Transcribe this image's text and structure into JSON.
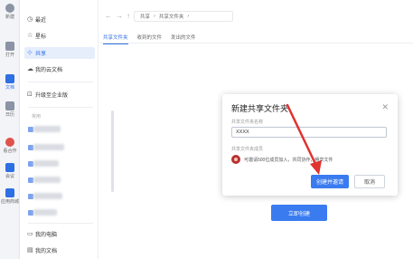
{
  "rail": {
    "items": [
      {
        "label": "新建",
        "icon": "plus-circle-icon",
        "color": "#8b93a5"
      },
      {
        "label": "打开",
        "icon": "folder-icon",
        "color": "#8b93a5"
      },
      {
        "label": "文档",
        "icon": "document-icon",
        "color": "#2f6fe4"
      },
      {
        "label": "日历",
        "icon": "calendar-icon",
        "color": "#8b93a5"
      },
      {
        "label": "看合作",
        "icon": "collaborate-icon",
        "color": "#e0524c"
      },
      {
        "label": "会议",
        "icon": "video-icon",
        "color": "#2f6fe4"
      },
      {
        "label": "应用商城",
        "icon": "apps-icon",
        "color": "#2f6fe4"
      }
    ]
  },
  "sidebar": {
    "items": [
      {
        "label": "最近",
        "icon": "clock-icon"
      },
      {
        "label": "星标",
        "icon": "star-icon"
      },
      {
        "label": "共享",
        "icon": "share-icon",
        "active": true
      },
      {
        "label": "我的云文档",
        "icon": "cloud-icon"
      },
      {
        "label": "升级至企业版",
        "icon": "upgrade-icon"
      }
    ],
    "section_label": "常用",
    "bottom_items": [
      {
        "label": "我的电脑",
        "icon": "computer-icon"
      },
      {
        "label": "我的文档",
        "icon": "my-documents-icon"
      }
    ]
  },
  "topbar": {
    "back_icon": "arrow-left-icon",
    "forward_icon": "arrow-right-icon",
    "up_icon": "arrow-up-icon",
    "breadcrumbs": [
      "共享",
      "共享文件夹"
    ]
  },
  "tabs": [
    {
      "label": "共享文件夹",
      "active": true
    },
    {
      "label": "收到的文件"
    },
    {
      "label": "发出的文件"
    }
  ],
  "main": {
    "create_button": "立即创建"
  },
  "dialog": {
    "title": "新建共享文件夹",
    "name_label": "共享文件夹名称",
    "name_value": "XXXX",
    "members_label": "共享文件夹成员",
    "members_text": "可邀请500位成员加入，共同协作，畅享文件",
    "primary_button": "创建并邀请",
    "cancel_button": "取消",
    "accent_color": "#3a7bf0"
  },
  "annotation": {
    "color": "#e0322f"
  }
}
